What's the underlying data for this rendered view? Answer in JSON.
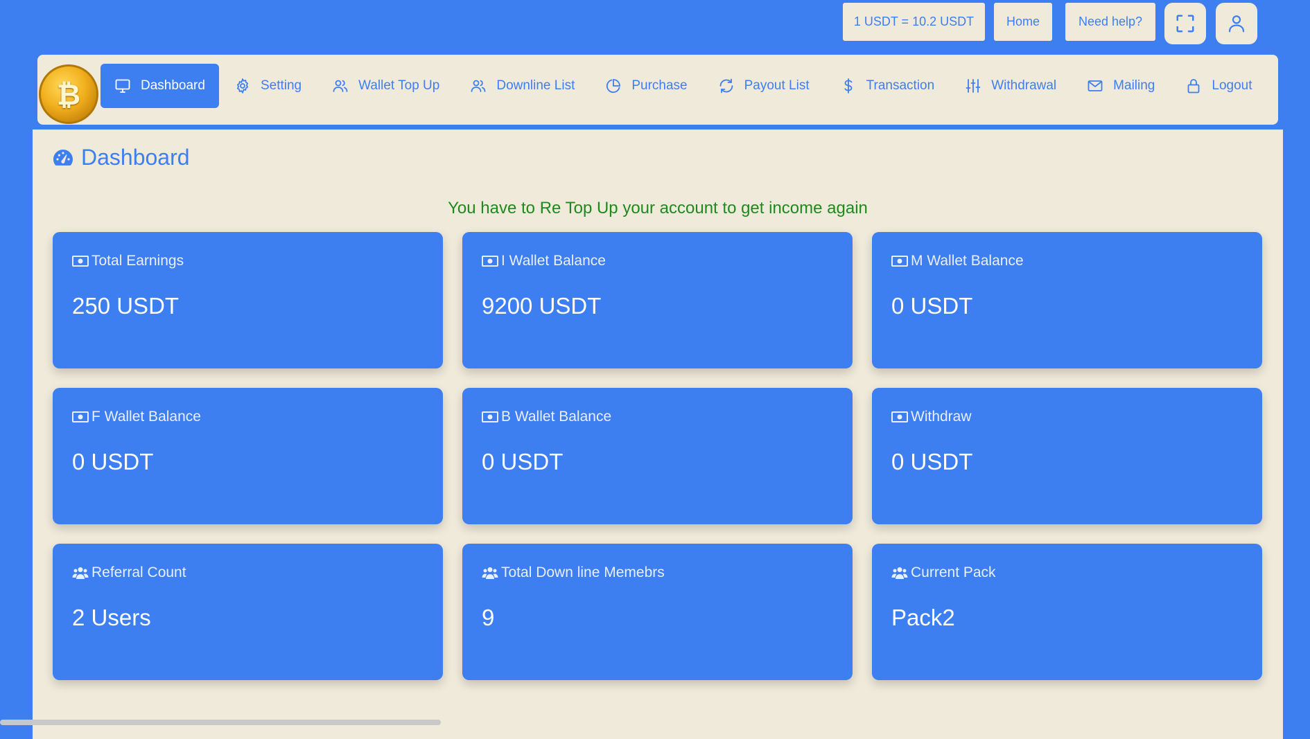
{
  "topbar": {
    "rate": "1 USDT = 10.2 USDT",
    "home": "Home",
    "help": "Need help?"
  },
  "logo_icon": "bitcoin-icon",
  "nav": {
    "items": [
      {
        "label": "Dashboard",
        "icon": "monitor-icon"
      },
      {
        "label": "Setting",
        "icon": "gear-icon"
      },
      {
        "label": "Wallet Top Up",
        "icon": "users-icon"
      },
      {
        "label": "Downline List",
        "icon": "users-icon"
      },
      {
        "label": "Purchase",
        "icon": "pie-chart-icon"
      },
      {
        "label": "Payout List",
        "icon": "refresh-icon"
      },
      {
        "label": "Transaction",
        "icon": "dollar-icon"
      },
      {
        "label": "Withdrawal",
        "icon": "sliders-icon"
      },
      {
        "label": "Mailing",
        "icon": "mail-icon"
      },
      {
        "label": "Logout",
        "icon": "lock-icon"
      }
    ]
  },
  "page": {
    "title": "Dashboard",
    "notice": "You have to Re Top Up your account to get income again"
  },
  "cards": [
    {
      "label": "Total Earnings",
      "value": "250 USDT",
      "icon": "money-icon"
    },
    {
      "label": "I Wallet Balance",
      "value": "9200 USDT",
      "icon": "money-icon"
    },
    {
      "label": "M Wallet Balance",
      "value": "0 USDT",
      "icon": "money-icon"
    },
    {
      "label": "F Wallet Balance",
      "value": "0 USDT",
      "icon": "money-icon"
    },
    {
      "label": "B Wallet Balance",
      "value": "0 USDT",
      "icon": "money-icon"
    },
    {
      "label": "Withdraw",
      "value": "0 USDT",
      "icon": "money-icon"
    },
    {
      "label": "Referral Count",
      "value": "2 Users",
      "icon": "users-group-icon"
    },
    {
      "label": "Total Down line Memebrs",
      "value": "9",
      "icon": "users-group-icon"
    },
    {
      "label": "Current Pack",
      "value": "Pack2",
      "icon": "users-group-icon"
    }
  ],
  "colors": {
    "primary": "#3d7ef0",
    "panel": "#f0eadb",
    "notice": "#1e8a1e"
  }
}
